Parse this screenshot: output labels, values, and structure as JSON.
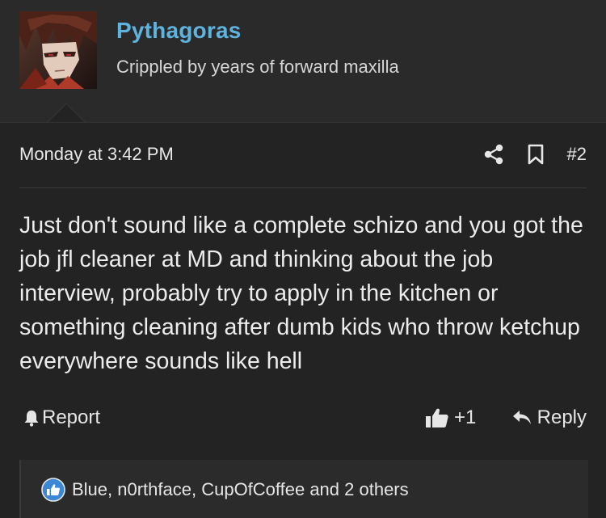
{
  "user": {
    "name": "Pythagoras",
    "title": "Crippled by years of forward maxilla",
    "avatar_icon": "anime-character-avatar"
  },
  "post": {
    "date": "Monday at 3:42 PM",
    "number": "#2",
    "body": "Just don't sound like a complete schizo and you got the job jfl cleaner at MD and thinking about the job interview, probably try to apply in the kitchen or something cleaning after dumb kids who throw ketchup everywhere sounds like hell"
  },
  "meta_icons": {
    "share": "share-icon",
    "bookmark": "bookmark-icon"
  },
  "actions": {
    "report_label": "Report",
    "like_label": "+1",
    "reply_label": "Reply"
  },
  "reactions": {
    "text": "Blue, n0rthface, CupOfCoffee and 2 others"
  },
  "colors": {
    "background": "#232323",
    "header_background": "#2a2a2a",
    "username": "#5fb4df",
    "reaction_badge": "#3c88d6"
  }
}
